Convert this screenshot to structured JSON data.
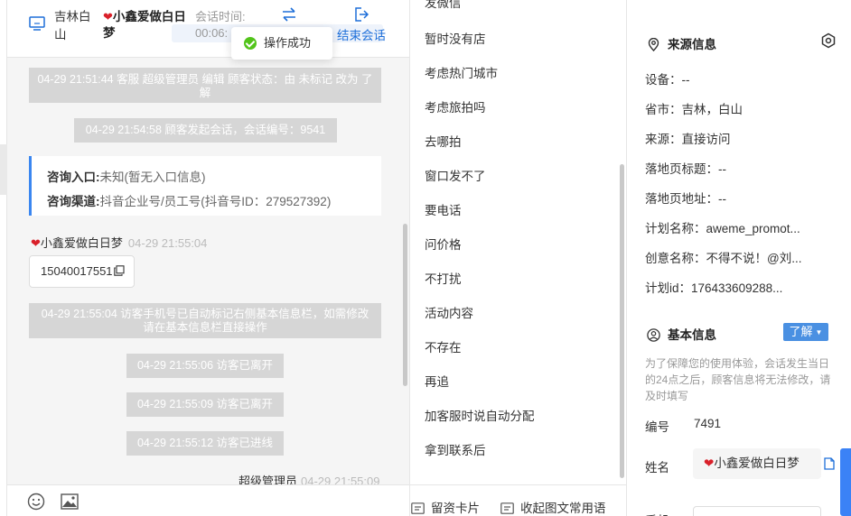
{
  "header": {
    "region": "吉林白山",
    "visitor_name": "小鑫爱做白日梦",
    "session_time_label": "会话时间:",
    "session_time_value": "00:06:",
    "end_session_label": "结束会话"
  },
  "toast": {
    "text": "操作成功"
  },
  "messages": {
    "sys1": "04-29 21:51:44 客服 超级管理员 编辑 顾客状态：由 未标记 改为 了解",
    "sys2": "04-29 21:54:58 顾客发起会话，会话编号：9541",
    "card": {
      "entry_label": "咨询入口:",
      "entry_value": "未知(暂无入口信息)",
      "channel_label": "咨询渠道:",
      "channel_value": "抖音企业号/员工号(抖音号ID：279527392)"
    },
    "visitor_msg": {
      "name": "小鑫爱做白日梦",
      "time": "04-29 21:55:04",
      "content": "15040017551"
    },
    "sys3": "04-29 21:55:04 访客手机号已自动标记右侧基本信息栏，如需修改请在基本信息栏直接操作",
    "sys4": "04-29 21:55:06 访客已离开",
    "sys5": "04-29 21:55:09 访客已离开",
    "sys6": "04-29 21:55:12 访客已进线",
    "last_sender": "超级管理员",
    "last_time": "04-29 21:55:09"
  },
  "phrases": {
    "items": [
      "发微信",
      "暂时没有店",
      "考虑热门城市",
      "考虑旅拍吗",
      "去哪拍",
      "窗口发不了",
      "要电话",
      "问价格",
      "不打扰",
      "活动内容",
      "不存在",
      "再追",
      "加客服时说自动分配",
      "拿到联系后"
    ],
    "btn_card": "留资卡片",
    "btn_collapse": "收起图文常用语"
  },
  "source_info": {
    "title": "来源信息",
    "device": "设备：--",
    "province_city": "省市：吉林，白山",
    "source": "来源：直接访问",
    "landing_title": "落地页标题：--",
    "landing_url": "落地页地址：--",
    "plan_name": "计划名称：aweme_promot...",
    "creative_name": "创意名称：不得不说！@刘...",
    "plan_id": "计划id：176433609288..."
  },
  "basic_info": {
    "title": "基本信息",
    "learn_label": "了解",
    "notice": "为了保障您的使用体验，会话发生当日的24点之后，顾客信息将无法修改，请及时填写",
    "id_label": "编号",
    "id_value": "7491",
    "name_label": "姓名",
    "name_value": "小鑫爱做白日梦",
    "next_label": "手机"
  },
  "colors": {
    "accent": "#1e6fd9",
    "learn_button": "#4a90e2",
    "success": "#52c41a",
    "system_bubble": "#d6d6d6",
    "heart": "#d9202a"
  }
}
